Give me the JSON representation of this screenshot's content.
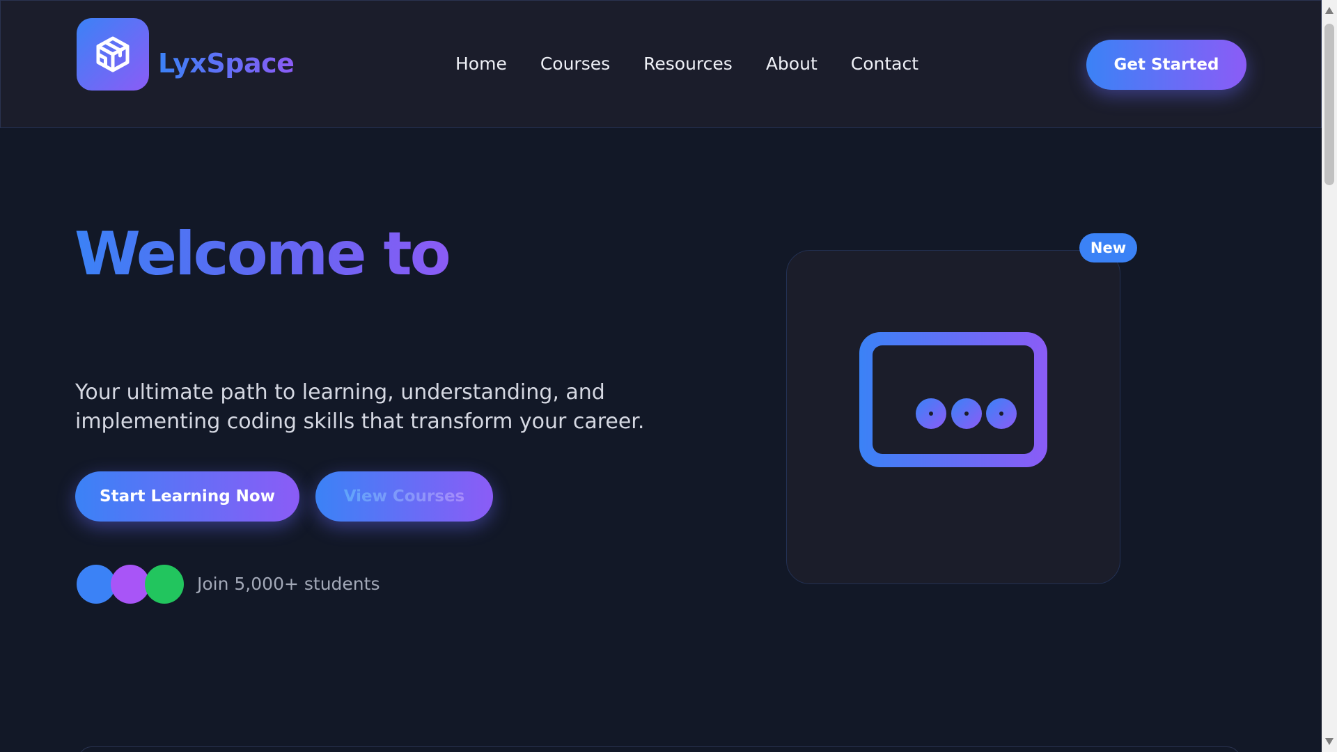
{
  "brand": {
    "name": "LyxSpace",
    "logo_icon": "cube-icon"
  },
  "nav": {
    "items": [
      {
        "label": "Home"
      },
      {
        "label": "Courses"
      },
      {
        "label": "Resources"
      },
      {
        "label": "About"
      },
      {
        "label": "Contact"
      }
    ],
    "cta_label": "Get Started"
  },
  "hero": {
    "title": "Welcome to",
    "subtitle": "Your ultimate path to learning, understanding, and implementing coding skills that transform your career.",
    "primary_button": "Start Learning Now",
    "secondary_button": "View Courses",
    "social_proof": "Join 5,000+ students",
    "avatar_colors": [
      "#3b82f6",
      "#a855f7",
      "#22c55e"
    ]
  },
  "card": {
    "badge": "New",
    "illustration_icon": "chat-window-icon"
  },
  "colors": {
    "background": "#121827",
    "header_background": "#1b1d2b",
    "accent_start": "#3b82f6",
    "accent_end": "#8b5cf6"
  }
}
